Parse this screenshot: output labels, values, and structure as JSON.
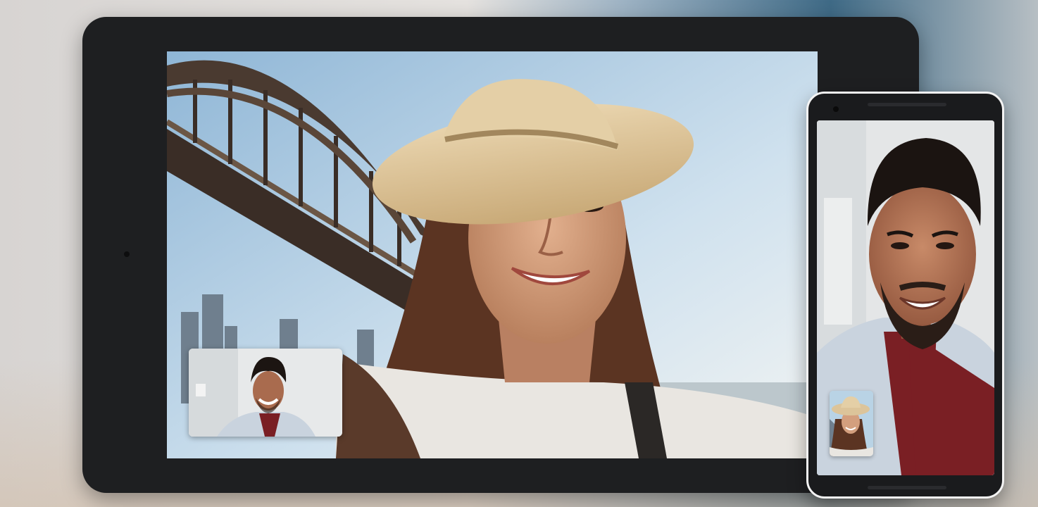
{
  "scene": {
    "colors": {
      "tablet_body": "#1e1f21",
      "phone_body": "#1a1b1d",
      "phone_border": "#f3f3f3",
      "sky": "#b8d3e6",
      "bridge": "#3f3028",
      "hat": "#dcc49a",
      "hair": "#5b3422",
      "skin_woman": "#c99574",
      "skin_man": "#a96b4e",
      "shirt_man": "#7a1f24",
      "jacket_man": "#c9d3de"
    },
    "icons": [
      "tablet-camera-icon",
      "phone-camera-icon"
    ]
  }
}
